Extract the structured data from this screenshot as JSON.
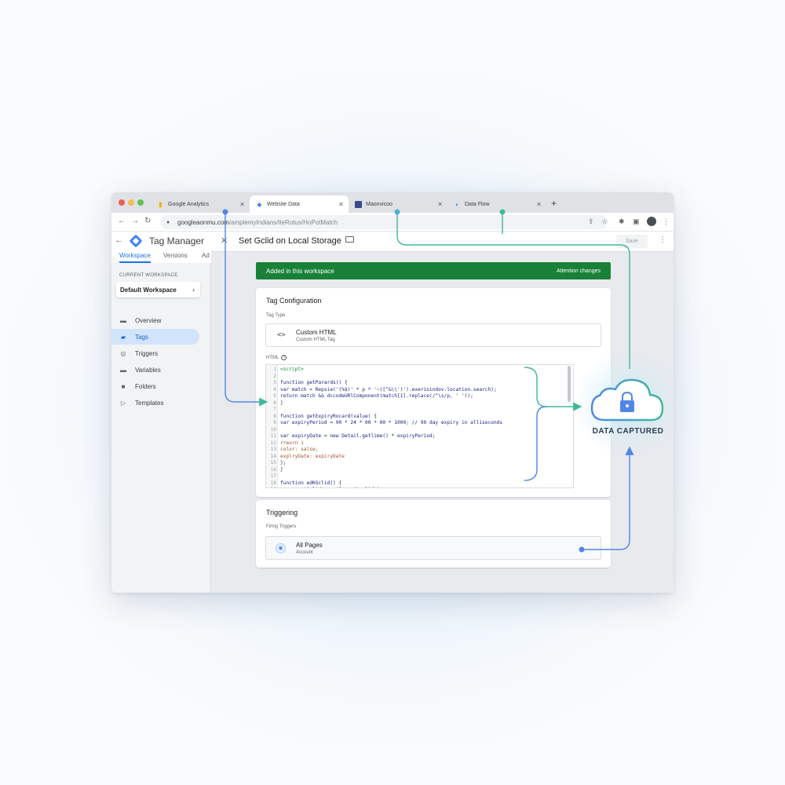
{
  "browser": {
    "tabs": [
      {
        "title": "Google Analytics",
        "active": false
      },
      {
        "title": "Website Data",
        "active": true
      },
      {
        "title": "Maonvicoo",
        "active": false
      },
      {
        "title": "Data Flow",
        "active": false
      }
    ],
    "new_tab": "+",
    "url_main": "googleaonmu.com",
    "url_rest": "/amplemyIndians/IleRotus/HoPotMatch"
  },
  "gtm": {
    "title": "Tag Manager",
    "tabs": [
      "Workspace",
      "Versions",
      "Ad"
    ],
    "current_workspace_label": "CURRENT WORKSPACE",
    "workspace_name": "Default Workspace",
    "nav": [
      {
        "label": "Overview",
        "icon": "briefcase-icon",
        "active": false
      },
      {
        "label": "Tags",
        "icon": "tag-icon",
        "active": true
      },
      {
        "label": "Triggers",
        "icon": "trigger-icon",
        "active": false
      },
      {
        "label": "Variables",
        "icon": "variables-icon",
        "active": false
      },
      {
        "label": "Folders",
        "icon": "folder-icon",
        "active": false
      },
      {
        "label": "Templates",
        "icon": "template-icon",
        "active": false
      }
    ]
  },
  "editor": {
    "tag_name": "Set Gclid on Local Storage",
    "save_label": "Save",
    "banner_text": "Added in this workspace",
    "banner_action": "Attention changes",
    "config_title": "Tag Configuration",
    "tag_type_label": "Tag Type",
    "tag_type_name": "Custom HTML",
    "tag_type_sub": "Custom HTML Tag",
    "html_label": "HTML",
    "code_lines": [
      "<script>",
      "",
      "function getParards() {",
      "var match = Repsie('(%$)' * p * '~([^&\\\\')').exerioindov.location.search);",
      "return match && dccodeURlComponent(match[1].replace(/^\\s/p, ' '));",
      "}",
      "",
      "function getExpiryRocard(value) {",
      "var expiryPeriod = 90 * 24 * 00 * 00 * 1000; // 90 day expiry in alliseconds",
      "",
      "var expiryDate = new Detail.getlime() * expiryPeriod;",
      "rreurn 1",
      "color: salse,",
      "explryDate: expiryDate",
      "};",
      "}",
      "",
      "function edKGclid() {",
      "  var getGclid = getParam('gclid');"
    ],
    "triggering_title": "Triggering",
    "firing_label": "Firing Triggers",
    "trigger_name": "All Pages",
    "trigger_sub": "Account"
  },
  "diagram": {
    "captured_label": "DATA CAPTURED",
    "accent_teal": "#3fb99a",
    "accent_blue": "#4f86e8"
  }
}
